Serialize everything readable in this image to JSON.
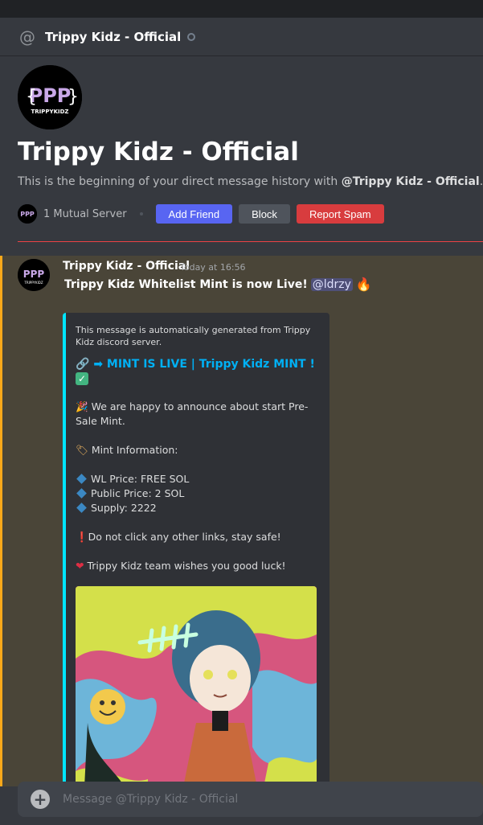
{
  "header": {
    "title": "Trippy Kidz - Official",
    "at_icon": "at-icon"
  },
  "intro": {
    "logo_text": "PPP",
    "logo_sub": "TRIPPYKIDZ",
    "title": "Trippy Kidz - Official",
    "desc_prefix": "This is the beginning of your direct message history with ",
    "desc_name": "@Trippy Kidz - Official",
    "desc_suffix": ".",
    "mutual_servers": "1 Mutual Server",
    "add_friend": "Add Friend",
    "block": "Block",
    "report_spam": "Report Spam"
  },
  "message": {
    "author": "Trippy Kidz - Official",
    "timestamp": "Today at 16:56",
    "text": "Trippy Kidz Whitelist Mint is now Live!",
    "mention": "@ldrzy"
  },
  "embed": {
    "author_text": "This message is automatically generated from Trippy Kidz discord server.",
    "title": "➡ MINT IS LIVE | Trippy Kidz MINT !",
    "announce": "We are happy to announce about start Pre-Sale Mint.",
    "mint_info": "Mint Information:",
    "wl_price": "WL Price: FREE SOL",
    "public_price": "Public Price: 2 SOL",
    "supply": "Supply: 2222",
    "warning": "Do not click any other links, stay safe!",
    "good_luck": "Trippy Kidz team wishes you good luck!"
  },
  "input": {
    "placeholder": "Message @Trippy Kidz - Official"
  },
  "colors": {
    "accent_blue": "#5865f2",
    "danger_red": "#d83c3e",
    "embed_bar": "#00e5ff",
    "highlight_bar": "#faa81a"
  }
}
